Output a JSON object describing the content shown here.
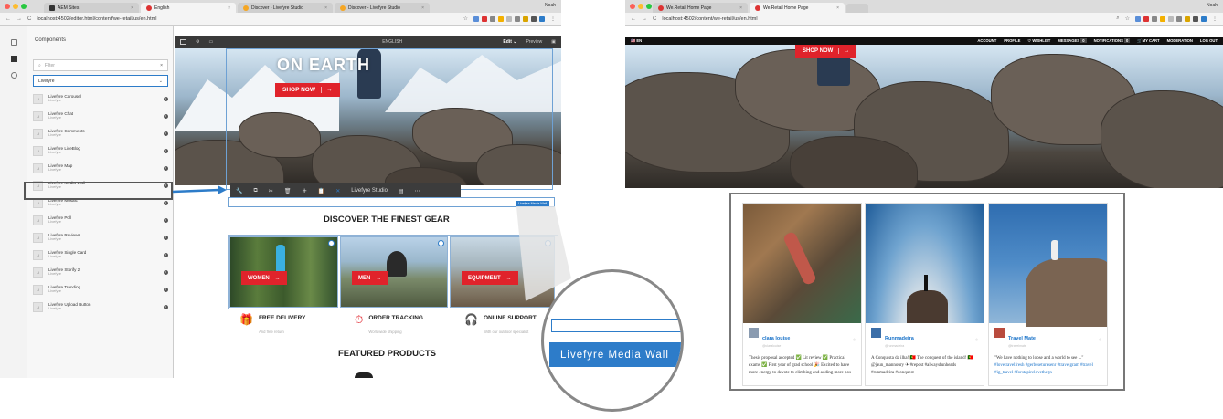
{
  "left_window": {
    "tabs": [
      {
        "label": "AEM Sites",
        "active": false
      },
      {
        "label": "English",
        "active": true
      },
      {
        "label": "Discover - Livefyre Studio",
        "active": false
      },
      {
        "label": "Discover - Livefyre Studio",
        "active": false
      }
    ],
    "user": "Noah",
    "url": "localhost:4502/editor.html/content/we-retail/us/en.html",
    "components_panel": {
      "title": "Components",
      "filter_placeholder": "Filter",
      "group_select": "Livefyre",
      "items": [
        {
          "name": "Livefyre Carousel",
          "group": "Livefyre"
        },
        {
          "name": "Livefyre Chat",
          "group": "Livefyre"
        },
        {
          "name": "Livefyre Comments",
          "group": "Livefyre"
        },
        {
          "name": "Livefyre LiveBlog",
          "group": "Livefyre"
        },
        {
          "name": "Livefyre Map",
          "group": "Livefyre"
        },
        {
          "name": "Livefyre Media Wall",
          "group": "Livefyre",
          "highlighted": true
        },
        {
          "name": "Livefyre Mosaic",
          "group": "Livefyre"
        },
        {
          "name": "Livefyre Poll",
          "group": "Livefyre"
        },
        {
          "name": "Livefyre Reviews",
          "group": "Livefyre"
        },
        {
          "name": "Livefyre Single Card",
          "group": "Livefyre"
        },
        {
          "name": "Livefyre Storify 2",
          "group": "Livefyre"
        },
        {
          "name": "Livefyre Trending",
          "group": "Livefyre"
        },
        {
          "name": "Livefyre Upload Button",
          "group": "Livefyre"
        }
      ],
      "item_icon_label": "LI"
    },
    "editor": {
      "language": "ENGLISH",
      "mode": "Edit",
      "preview": "Preview",
      "hero_title": "ON EARTH",
      "shop_now": "SHOP NOW",
      "toolbar_label": "Livefyre Studio",
      "component_tag": "Livefyre Media Wall",
      "discover_heading": "DISCOVER THE FINEST GEAR",
      "categories": [
        "WOMEN",
        "MEN",
        "EQUIPMENT"
      ],
      "features": [
        {
          "title": "FREE DELIVERY",
          "sub": "And free return"
        },
        {
          "title": "ORDER TRACKING",
          "sub": "Worldwide shipping"
        },
        {
          "title": "ONLINE SUPPORT",
          "sub": "With our outdoor specialist"
        }
      ],
      "featured_heading": "FEATURED PRODUCTS"
    },
    "zoom_label": "Livefyre Media Wall"
  },
  "right_window": {
    "tabs": [
      {
        "label": "We.Retail Home Page",
        "active": false
      },
      {
        "label": "We.Retail Home Page",
        "active": true
      }
    ],
    "user": "Noah",
    "url": "localhost:4502/content/we-retail/us/en.html",
    "site_nav": {
      "locale": "EN",
      "links": [
        "ACCOUNT",
        "PROFILE",
        "WISHLIST",
        "MESSAGES",
        "NOTIFICATIONS",
        "MY CART",
        "MODERATION",
        "LOG OUT"
      ],
      "messages_count": "0",
      "notifications_count": "0"
    },
    "shop_now": "SHOP NOW",
    "media_wall_cards": [
      {
        "user": "clara louise",
        "handle": "@claralouise",
        "text": "Thesis proposal accepted ✅ Lit review ✅ Practical exams ✅ First year of grad school 🎉 Excited to have more energy to devote to climbing and adding more pos"
      },
      {
        "user": "Runmadeira",
        "handle": "@runmadeira",
        "text": "A Conquista da ilha! 🇵🇹 The conquest of the island! 🇵🇹 @jaun_mannoury ✈ #repost #alwaysfunheads #runmadeira #conquest"
      },
      {
        "user": "Travel Mate",
        "handle": "@travelmate",
        "text": "\"We have nothing to loose and a world to see ...\"",
        "tags": "#lovetravelfresh #gerbsseturesenr #travelgram #travel #ig_travel #forstapirelovethegn"
      }
    ]
  },
  "colors": {
    "brand_red": "#e0232b",
    "aem_blue": "#2d7cc9",
    "highlight_border": "#555555",
    "link_blue": "#1a73c9"
  }
}
